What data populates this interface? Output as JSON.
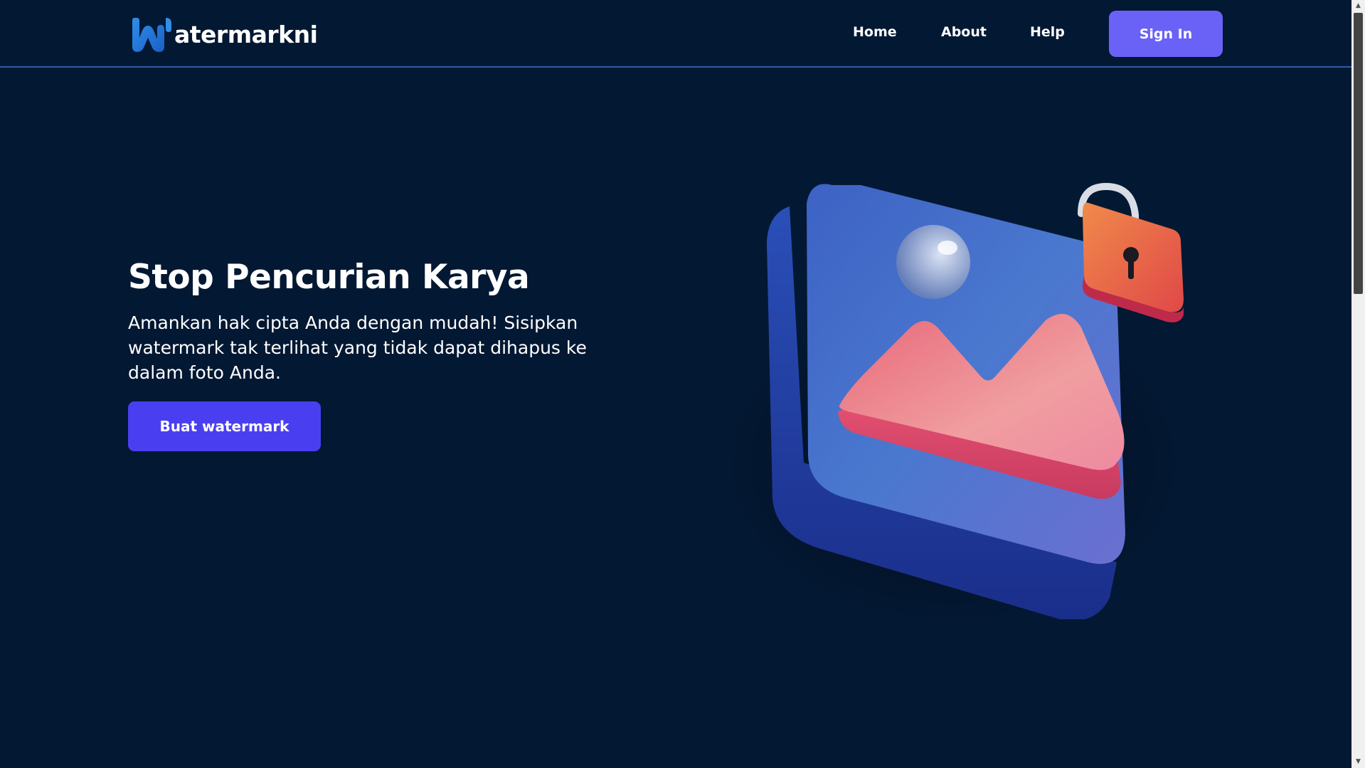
{
  "header": {
    "logo_text": "atermarkni",
    "logo_icon": "w-logo-icon",
    "nav": {
      "home": "Home",
      "about": "About",
      "help": "Help"
    },
    "signin_label": "Sign In"
  },
  "hero": {
    "title": "Stop Pencurian Karya",
    "description": "Amankan hak cipta Anda dengan mudah! Sisipkan watermark tak terlihat yang tidak dapat dihapus ke dalam foto Anda.",
    "cta_label": "Buat watermark",
    "illustration": "image-lock-illustration"
  },
  "colors": {
    "background": "#031833",
    "accent": "#6a62f6",
    "cta": "#4a3ff0",
    "header_border": "#2a5fa8"
  },
  "scrollbar": {
    "up_arrow": "▲",
    "down_arrow": "▼"
  }
}
